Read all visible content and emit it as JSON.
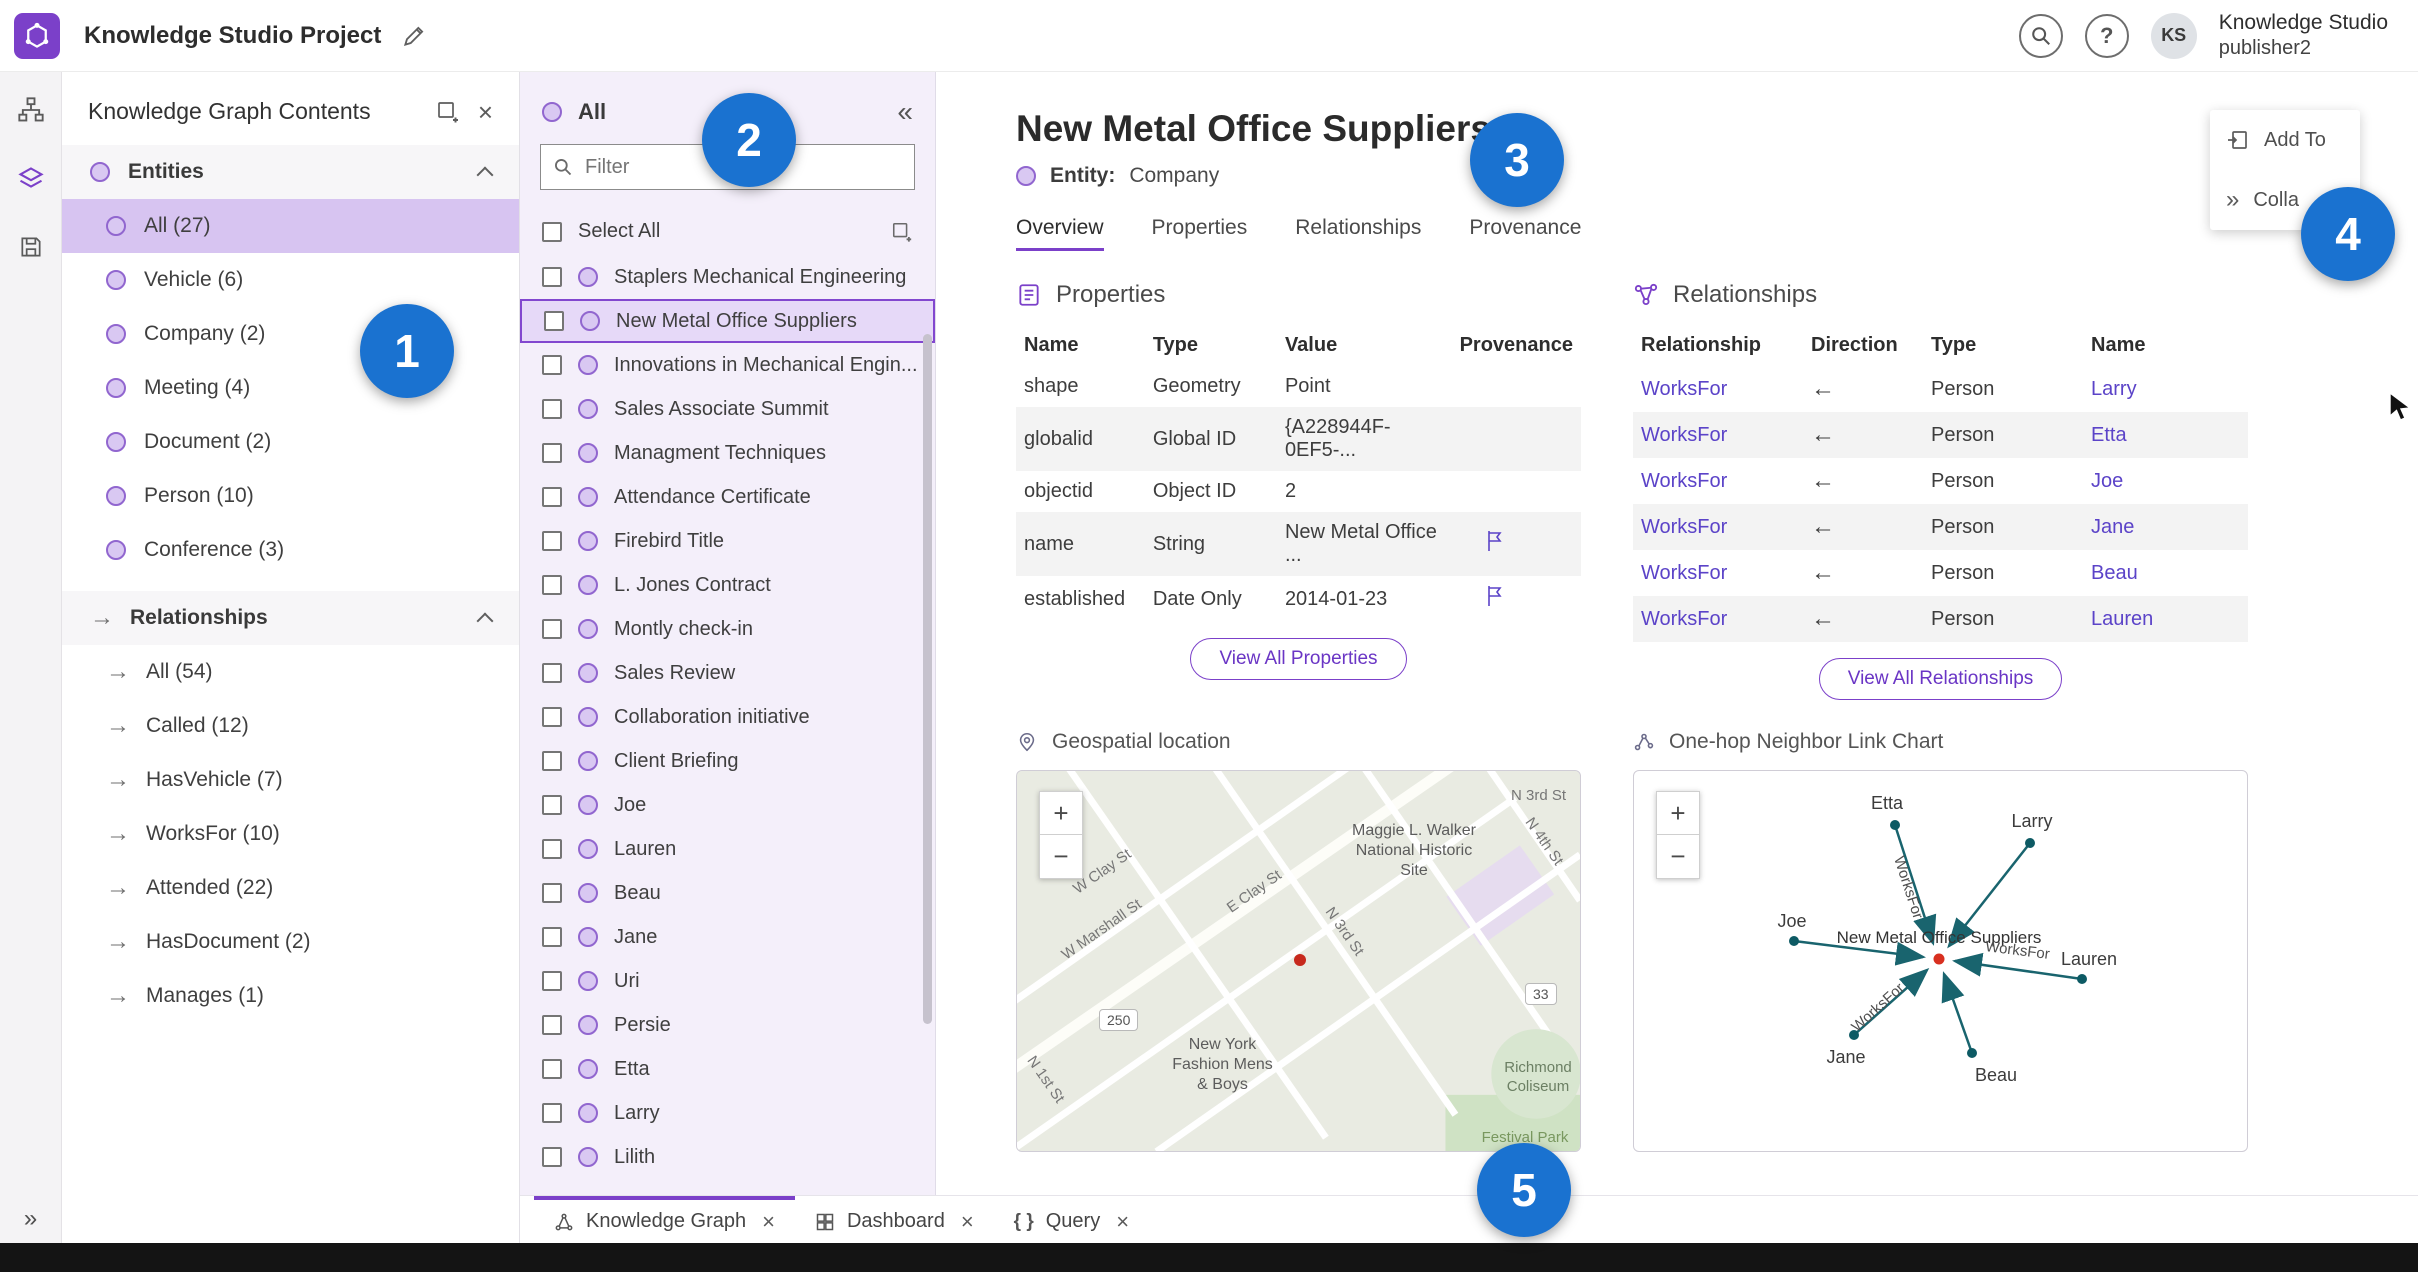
{
  "header": {
    "app_title": "Knowledge Studio Project",
    "account_name": "Knowledge Studio",
    "account_role": "publisher2",
    "avatar_initials": "KS",
    "help_glyph": "?"
  },
  "contents_panel": {
    "title": "Knowledge Graph Contents",
    "entities_label": "Entities",
    "relationships_label": "Relationships",
    "entities": [
      "All (27)",
      "Vehicle (6)",
      "Company (2)",
      "Meeting (4)",
      "Document (2)",
      "Person (10)",
      "Conference (3)"
    ],
    "relationships": [
      "All (54)",
      "Called (12)",
      "HasVehicle (7)",
      "WorksFor (10)",
      "Attended (22)",
      "HasDocument (2)",
      "Manages (1)"
    ]
  },
  "list_panel": {
    "title": "All",
    "filter_placeholder": "Filter",
    "select_all_label": "Select All",
    "items": [
      "Staplers Mechanical Engineering",
      "New Metal Office Suppliers",
      "Innovations in Mechanical Engin...",
      "Sales Associate Summit",
      "Managment Techniques",
      "Attendance Certificate",
      "Firebird Title",
      "L. Jones Contract",
      "Montly check-in",
      "Sales Review",
      "Collaboration initiative",
      "Client Briefing",
      "Joe",
      "Lauren",
      "Beau",
      "Jane",
      "Uri",
      "Persie",
      "Etta",
      "Larry",
      "Lilith"
    ]
  },
  "main": {
    "title": "New Metal Office Suppliers",
    "entity_label": "Entity:",
    "entity_value": "Company",
    "tabs": [
      "Overview",
      "Properties",
      "Relationships",
      "Provenance"
    ],
    "properties": {
      "title": "Properties",
      "columns": [
        "Name",
        "Type",
        "Value",
        "Provenance"
      ],
      "rows": [
        {
          "name": "shape",
          "type": "Geometry",
          "value": "Point"
        },
        {
          "name": "globalid",
          "type": "Global ID",
          "value": "{A228944F-0EF5-..."
        },
        {
          "name": "objectid",
          "type": "Object ID",
          "value": "2"
        },
        {
          "name": "name",
          "type": "String",
          "value": "New Metal Office ..."
        },
        {
          "name": "established",
          "type": "Date Only",
          "value": "2014-01-23"
        }
      ],
      "view_all_label": "View All Properties"
    },
    "relationships": {
      "title": "Relationships",
      "columns": [
        "Relationship",
        "Direction",
        "Type",
        "Name"
      ],
      "rows": [
        {
          "relationship": "WorksFor",
          "direction": "←",
          "type": "Person",
          "name": "Larry"
        },
        {
          "relationship": "WorksFor",
          "direction": "←",
          "type": "Person",
          "name": "Etta"
        },
        {
          "relationship": "WorksFor",
          "direction": "←",
          "type": "Person",
          "name": "Joe"
        },
        {
          "relationship": "WorksFor",
          "direction": "←",
          "type": "Person",
          "name": "Jane"
        },
        {
          "relationship": "WorksFor",
          "direction": "←",
          "type": "Person",
          "name": "Beau"
        },
        {
          "relationship": "WorksFor",
          "direction": "←",
          "type": "Person",
          "name": "Lauren"
        }
      ],
      "view_all_label": "View All Relationships"
    },
    "geospatial": {
      "title": "Geospatial location",
      "streets": [
        "W Clay St",
        "E Clay St",
        "W Marshall St",
        "N 3rd St",
        "N 4th St",
        "N 1st St"
      ],
      "places": {
        "historic_site": "Maggie L. Walker National Historic Site",
        "fashion": "New York Fashion Mens & Boys",
        "coliseum": "Richmond Coliseum",
        "park": "Festival Park"
      },
      "route_shields": [
        "250",
        "33"
      ]
    },
    "link_chart": {
      "title": "One-hop Neighbor Link Chart",
      "center_label": "New Metal Office Suppliers",
      "edge_label": "WorksFor",
      "nodes": [
        "Etta",
        "Larry",
        "Joe",
        "Lauren",
        "Jane",
        "Beau"
      ]
    }
  },
  "context_menu": {
    "items": [
      {
        "label": "Add To"
      },
      {
        "label": "Colla"
      }
    ]
  },
  "bottom_tabs": [
    {
      "label": "Knowledge Graph"
    },
    {
      "label": "Dashboard"
    },
    {
      "label": "Query"
    }
  ],
  "annotations": [
    "1",
    "2",
    "3",
    "4",
    "5"
  ],
  "colors": {
    "accent_purple": "#7b40c9",
    "annotation_blue": "#1a72d0",
    "link_purple": "#5b43c8",
    "edge_teal": "#19646e",
    "center_node_red": "#d83020"
  }
}
